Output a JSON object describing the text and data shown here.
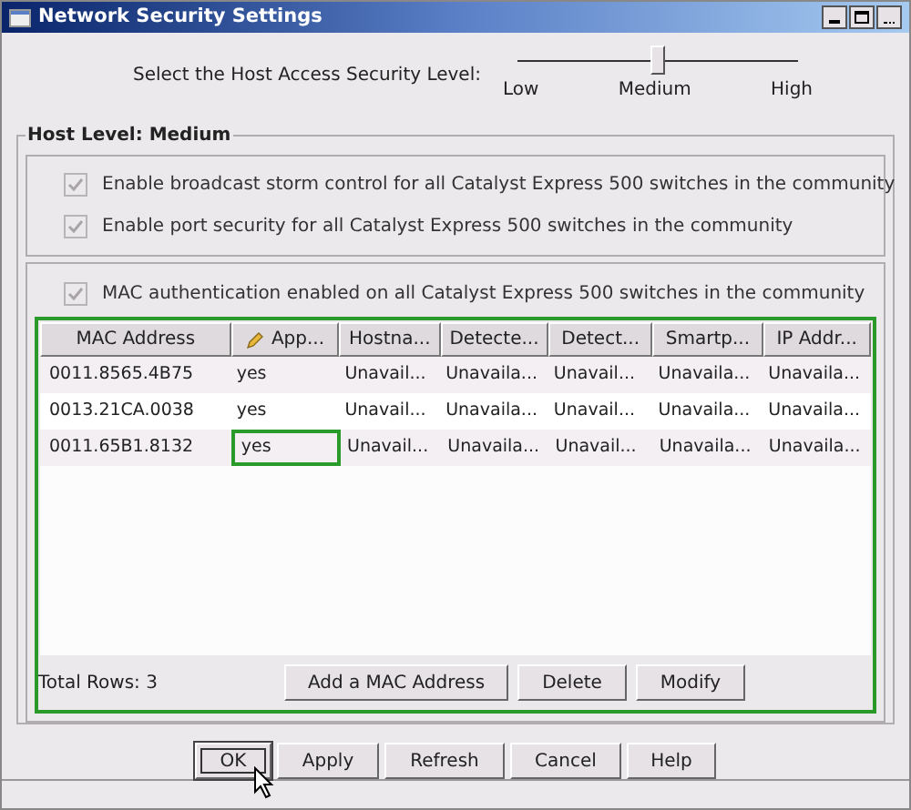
{
  "window": {
    "title": "Network Security Settings"
  },
  "security_level": {
    "label": "Select the Host Access Security Level:",
    "level": 0.5,
    "ticks": [
      "Low",
      "Medium",
      "High"
    ]
  },
  "host_level": {
    "title": "Host Level: Medium",
    "options": [
      {
        "label": "Enable broadcast storm control for all Catalyst Express 500 switches in the community",
        "checked": true,
        "disabled": true
      },
      {
        "label": "Enable port security for all Catalyst Express 500 switches in the community",
        "checked": true,
        "disabled": true
      }
    ],
    "mac_auth": {
      "label": "MAC authentication enabled on all Catalyst Express 500 switches in the community",
      "checked": true,
      "disabled": true
    }
  },
  "table": {
    "columns": [
      {
        "label": "MAC Address",
        "editable": false
      },
      {
        "label": "App...",
        "editable": true
      },
      {
        "label": "Hostna...",
        "editable": false
      },
      {
        "label": "Detecte...",
        "editable": false
      },
      {
        "label": "Detect...",
        "editable": false
      },
      {
        "label": "Smartp...",
        "editable": false
      },
      {
        "label": "IP Addr...",
        "editable": false
      }
    ],
    "rows": [
      {
        "cells": [
          {
            "text": "0011.8565.4B75",
            "focused": false
          },
          {
            "text": "yes",
            "focused": false
          },
          {
            "text": "Unavail...",
            "focused": false
          },
          {
            "text": "Unavaila...",
            "focused": false
          },
          {
            "text": "Unavail...",
            "focused": false
          },
          {
            "text": "Unavaila...",
            "focused": false
          },
          {
            "text": "Unavaila...",
            "focused": false
          }
        ]
      },
      {
        "cells": [
          {
            "text": "0013.21CA.0038",
            "focused": false
          },
          {
            "text": "yes",
            "focused": false
          },
          {
            "text": "Unavail...",
            "focused": false
          },
          {
            "text": "Unavaila...",
            "focused": false
          },
          {
            "text": "Unavail...",
            "focused": false
          },
          {
            "text": "Unavaila...",
            "focused": false
          },
          {
            "text": "Unavaila...",
            "focused": false
          }
        ]
      },
      {
        "cells": [
          {
            "text": "0011.65B1.8132",
            "focused": false
          },
          {
            "text": "yes",
            "focused": true
          },
          {
            "text": "Unavail...",
            "focused": false
          },
          {
            "text": "Unavaila...",
            "focused": false
          },
          {
            "text": "Unavail...",
            "focused": false
          },
          {
            "text": "Unavaila...",
            "focused": false
          },
          {
            "text": "Unavaila...",
            "focused": false
          }
        ]
      }
    ],
    "total_rows": "Total Rows: 3",
    "buttons": [
      "Add a MAC Address",
      "Delete",
      "Modify"
    ]
  },
  "buttons": [
    {
      "label": "OK",
      "focused": true
    },
    {
      "label": "Apply",
      "focused": false
    },
    {
      "label": "Refresh",
      "focused": false
    },
    {
      "label": "Cancel",
      "focused": false
    },
    {
      "label": "Help",
      "focused": false
    }
  ]
}
